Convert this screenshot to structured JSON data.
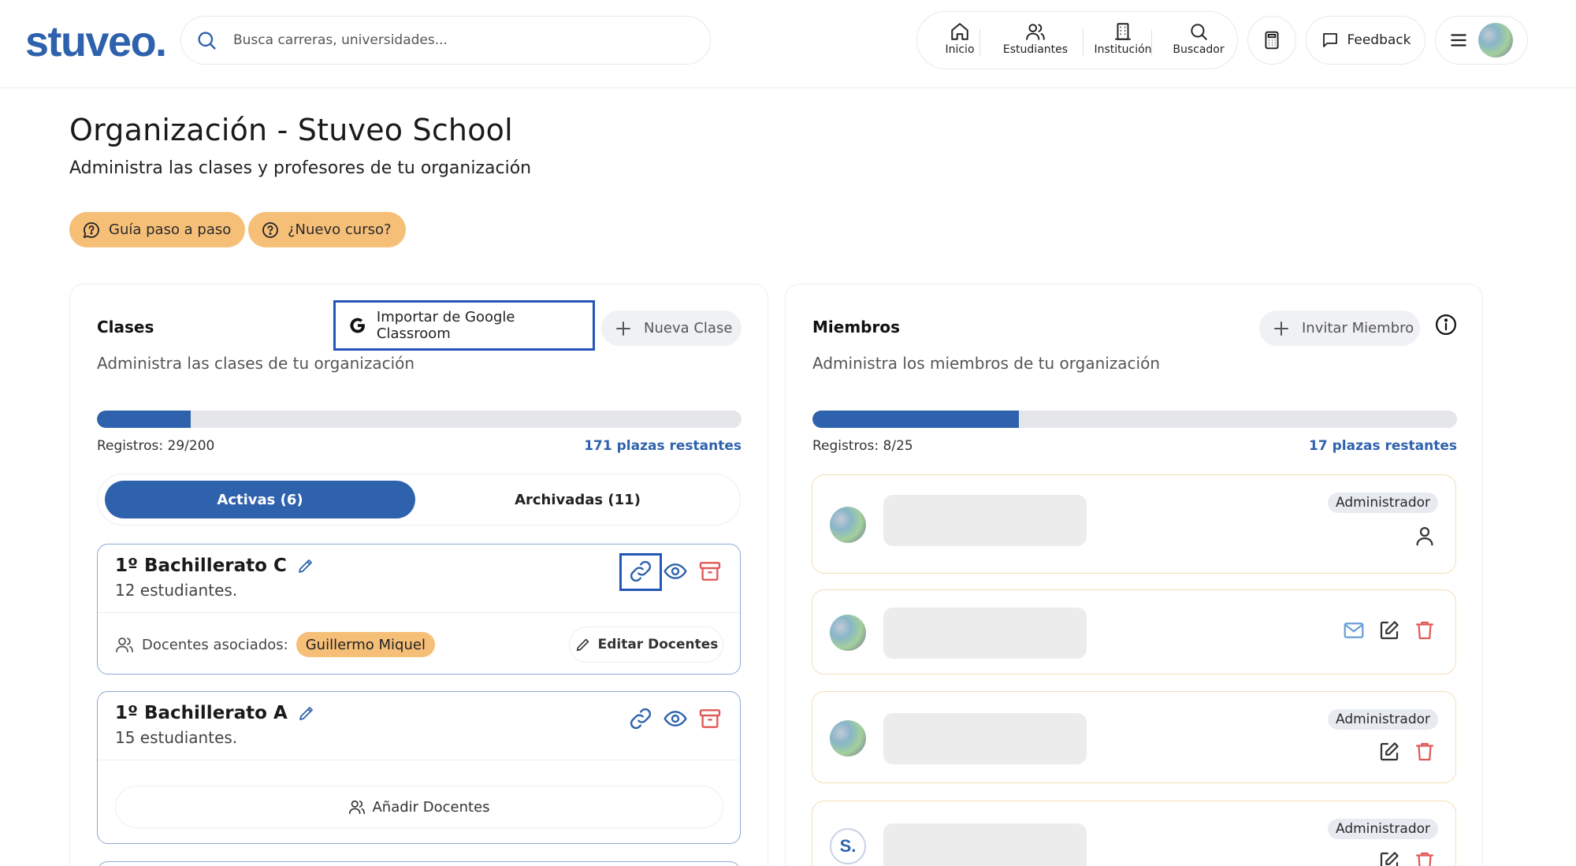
{
  "header": {
    "logo": "stuveo.",
    "search_placeholder": "Busca carreras, universidades...",
    "nav": [
      {
        "label": "Inicio",
        "icon": "home-icon"
      },
      {
        "label": "Estudiantes",
        "icon": "users-icon"
      },
      {
        "label": "Institución",
        "icon": "building-icon"
      },
      {
        "label": "Buscador",
        "icon": "search-icon"
      }
    ],
    "feedback_label": "Feedback"
  },
  "page": {
    "title": "Organización - Stuveo School",
    "subtitle": "Administra las clases y profesores de tu organización",
    "guide_label": "Guía paso a paso",
    "new_course_label": "¿Nuevo curso?"
  },
  "classes": {
    "title": "Clases",
    "subtitle": "Administra las clases de tu organización",
    "import_label": "Importar de Google Classroom",
    "new_label": "Nueva Clase",
    "registros": "Registros: 29/200",
    "progress_fraction": 0.145,
    "remaining": "171 plazas restantes",
    "tabs": {
      "active": "Activas (6)",
      "archived": "Archivadas (11)"
    },
    "items": [
      {
        "name": "1º Bachillerato C",
        "count": "12 estudiantes.",
        "teachers_label": "Docentes asociados:",
        "teacher": "Guillermo Miquel",
        "edit_label": "Editar Docentes"
      },
      {
        "name": "1º Bachillerato A",
        "count": "15 estudiantes.",
        "add_label": "Añadir Docentes"
      }
    ]
  },
  "members": {
    "title": "Miembros",
    "subtitle": "Administra los miembros de tu organización",
    "invite_label": "Invitar Miembro",
    "registros": "Registros: 8/25",
    "progress_fraction": 0.32,
    "remaining": "17 plazas restantes",
    "items": [
      {
        "role": "Administrador",
        "avatar_letter": ""
      },
      {
        "role": "",
        "avatar_letter": ""
      },
      {
        "role": "Administrador",
        "avatar_letter": ""
      },
      {
        "role": "Administrador",
        "avatar_letter": "S."
      }
    ]
  },
  "colors": {
    "brand": "#2f62ad",
    "accent_orange": "#f6bf78",
    "danger": "#e05a5a",
    "focus_outline": "#2456b8"
  }
}
